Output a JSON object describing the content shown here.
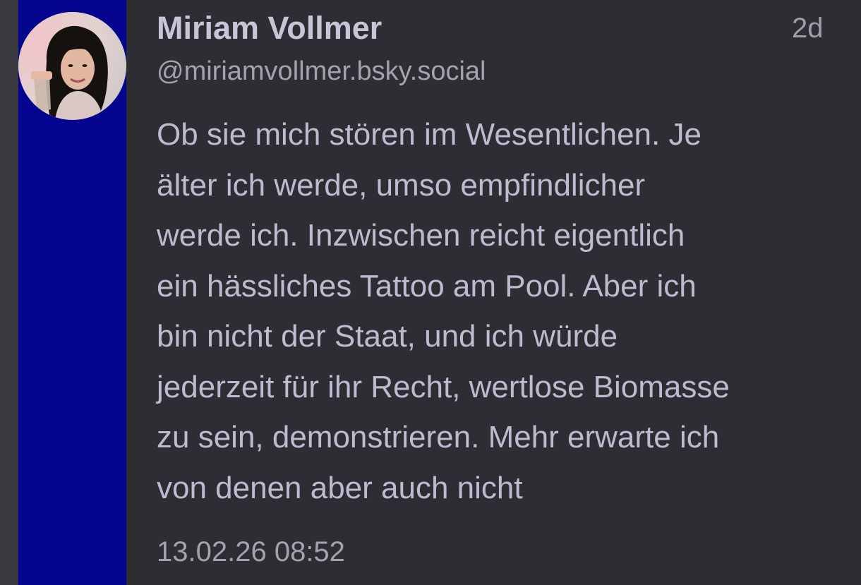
{
  "post": {
    "author_name": "Miriam Vollmer",
    "handle": "@miriamvollmer.bsky.social",
    "relative_time": "2d",
    "text_lines": [
      "Ob sie mich stören im Wesentlichen. Je",
      "älter ich werde, umso empfindlicher",
      "werde ich. Inzwischen reicht eigentlich",
      "ein hässliches Tattoo am Pool. Aber ich",
      "bin nicht der Staat, und ich würde",
      "jederzeit für ihr Recht, wertlose Biomasse",
      "zu sein, demonstrieren. Mehr erwarte ich",
      "von denen aber auch nicht"
    ],
    "timestamp": "13.02.26 08:52"
  },
  "colors": {
    "thread_bar": "#04048e",
    "background": "#2e2d33",
    "text": "#bdbbd0"
  }
}
